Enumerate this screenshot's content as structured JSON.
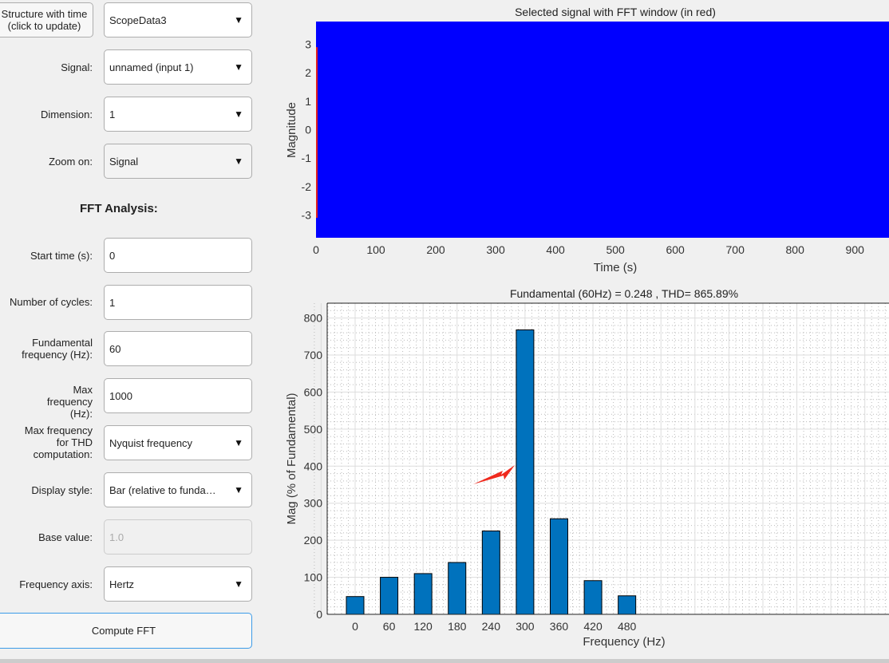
{
  "controls": {
    "structure_button": "Structure with time\n(click to update)",
    "structure_value": "ScopeData3",
    "signal_label": "Signal:",
    "signal_value": "unnamed (input 1)",
    "dimension_label": "Dimension:",
    "dimension_value": "1",
    "zoom_label": "Zoom on:",
    "zoom_value": "Signal",
    "fft_heading": "FFT Analysis:",
    "start_label": "Start time (s):",
    "start_value": "0",
    "cycles_label": "Number of cycles:",
    "cycles_value": "1",
    "fund_label": "Fundamental frequency (Hz):",
    "fund_value": "60",
    "maxf_label": "Max frequency (Hz):",
    "maxf_value": "1000",
    "thd_label": "Max frequency for THD computation:",
    "thd_value": "Nyquist frequency",
    "display_label": "Display style:",
    "display_value": "Bar (relative to funda…",
    "base_label": "Base value:",
    "base_value": "1.0",
    "freqaxis_label": "Frequency axis:",
    "freqaxis_value": "Hertz",
    "compute_button": "Compute FFT"
  },
  "chart_data": [
    {
      "type": "area",
      "title": "Selected signal with FFT window (in red)",
      "xlabel": "Time (s)",
      "ylabel": "Magnitude",
      "xlim": [
        0,
        957
      ],
      "ylim": [
        -3.8,
        3.8
      ],
      "xticks": [
        0,
        100,
        200,
        300,
        400,
        500,
        600,
        700,
        800,
        900
      ],
      "yticks": [
        -3,
        -2,
        -1,
        0,
        1,
        2,
        3
      ],
      "signal_color": "#0000ff",
      "window_color": "#e02020",
      "window_range": [
        0,
        1.0
      ],
      "window_y": [
        -3.1,
        2.9
      ]
    },
    {
      "type": "bar",
      "title": "Fundamental (60Hz) = 0.248 , THD= 865.89%",
      "xlabel": "Frequency (Hz)",
      "ylabel": "Mag (% of Fundamental)",
      "categories": [
        0,
        60,
        120,
        180,
        240,
        300,
        360,
        420,
        480
      ],
      "values": [
        48,
        100,
        110,
        140,
        225,
        768,
        258,
        91,
        50
      ],
      "ylim": [
        0,
        840
      ],
      "yticks": [
        0,
        100,
        200,
        300,
        400,
        500,
        600,
        700,
        800
      ],
      "grid": true,
      "bar_color": "#0072bd"
    }
  ]
}
